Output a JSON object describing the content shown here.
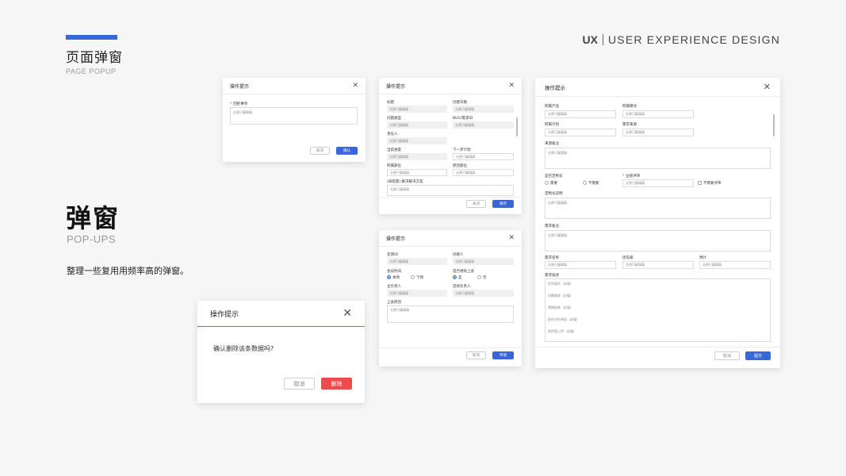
{
  "header": {
    "title": "页面弹窗",
    "subtitle": "PAGE POPUP",
    "brand_logo": "UX",
    "brand_text": "USER EXPERIENCE DESIGN",
    "accent_color": "#3a67d8"
  },
  "section": {
    "title": "弹窗",
    "subtitle": "POP-UPS",
    "description": "整理一些复用用频率高的弹窗。"
  },
  "common": {
    "dialog_title": "操作提示",
    "placeholder": "太原只疑填填",
    "cancel": "取消",
    "confirm": "确认",
    "close": "关闭",
    "save": "保存",
    "apply": "申请",
    "submit": "提交",
    "delete": "删除"
  },
  "dialog1": {
    "field_label": "回拒事项"
  },
  "dialog2": {
    "labels": [
      "标题",
      "创建天数",
      "问题类型",
      "BUG/需求ID",
      "责任人",
      "当前进度",
      "下一步计划",
      "所属部位",
      "原因部位",
      "(采取量) 解决解决方案"
    ]
  },
  "dialog3": {
    "labels": [
      "反馈ID",
      "创建人",
      "会议时间",
      "是否继续上会",
      "主负责人",
      "其他负责人",
      "上会原因"
    ],
    "radio_a": [
      "本周",
      "下周"
    ],
    "radio_b": [
      "是",
      "否"
    ]
  },
  "dialog4": {
    "labels": [
      "所属产品",
      "所属模块",
      "所属计划",
      "需求来源",
      "来源备注",
      "是否定制化",
      "业绩评审",
      "定制化说明",
      "需求备注",
      "需求名称",
      "优先级",
      "预计",
      "需求描述"
    ],
    "radio": [
      "需要",
      "不需要"
    ],
    "checkbox": "不需要评审",
    "desc_lines": [
      "优先级评（必填）",
      "问题描述（必填）",
      "预期结果（必填）",
      "现在分析原因（必填）",
      "附件图上传（必填）"
    ]
  },
  "confirm_dialog": {
    "message": "确认删除该条数据吗?"
  }
}
